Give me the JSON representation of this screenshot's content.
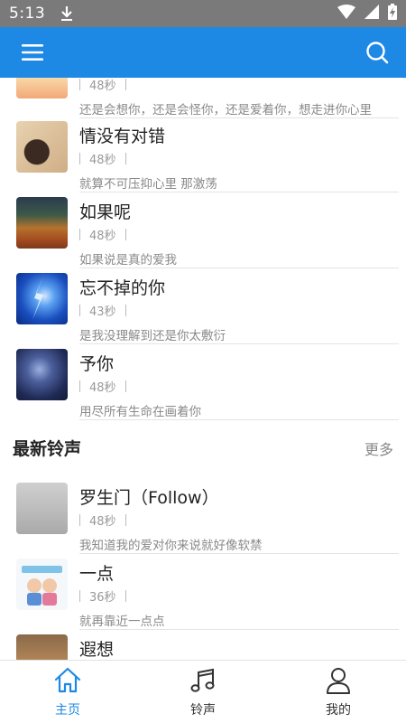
{
  "status_bar": {
    "time": "5:13"
  },
  "colors": {
    "accent": "#1e88e5",
    "status_bar": "#7a7a7a"
  },
  "songs_top": [
    {
      "title": "",
      "duration": "48秒",
      "lyric": "还是会想你，还是会怪你，还是爱着你，想走进你心里",
      "cover": "pink-cartoon"
    },
    {
      "title": "情没有对错",
      "duration": "48秒",
      "lyric": "就算不可压抑心里 那激荡",
      "cover": "woman-portrait"
    },
    {
      "title": "如果呢",
      "duration": "48秒",
      "lyric": "如果说是真的爱我",
      "cover": "autumn-forest"
    },
    {
      "title": "忘不掉的你",
      "duration": "43秒",
      "lyric": "是我没理解到还是你太敷衍",
      "cover": "lightning-sky"
    },
    {
      "title": "予你",
      "duration": "48秒",
      "lyric": "用尽所有生命在画着你",
      "cover": "night-stars"
    }
  ],
  "section": {
    "title": "最新铃声",
    "more": "更多"
  },
  "songs_new": [
    {
      "title": "罗生门（Follow）",
      "duration": "48秒",
      "lyric": "我知道我的爱对你来说就好像软禁",
      "cover": "foggy-grey"
    },
    {
      "title": "一点",
      "duration": "36秒",
      "lyric": "就再靠近一点点",
      "cover": "cartoon-couple"
    },
    {
      "title": "遐想",
      "duration": "",
      "lyric": "",
      "cover": "brown-field"
    }
  ],
  "tabs": [
    {
      "label": "主页",
      "icon": "home-icon",
      "active": true
    },
    {
      "label": "铃声",
      "icon": "music-note-icon",
      "active": false
    },
    {
      "label": "我的",
      "icon": "user-icon",
      "active": false
    }
  ]
}
